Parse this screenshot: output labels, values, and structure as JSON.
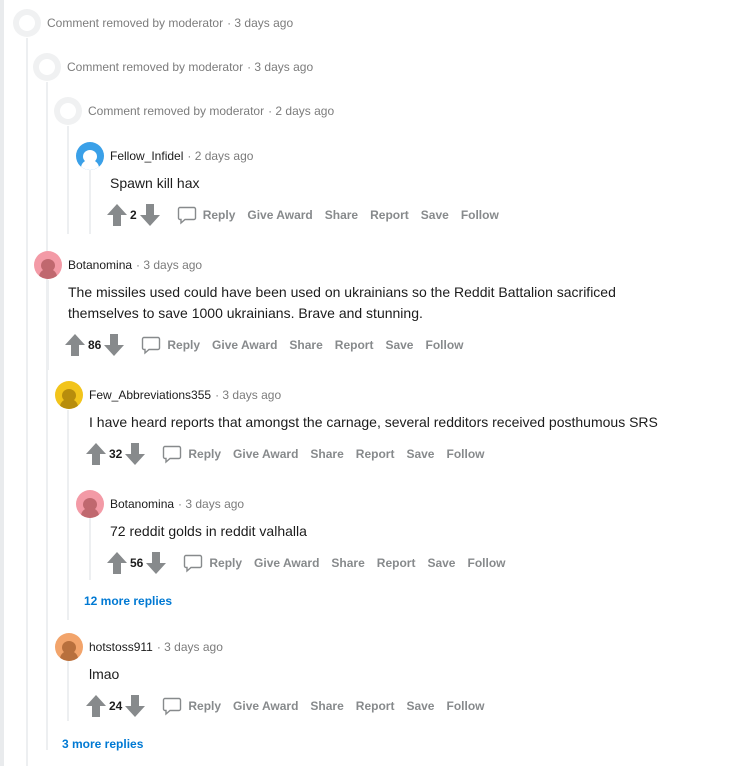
{
  "comments": {
    "c1": {
      "text": "Comment removed by moderator",
      "time": "· 3 days ago"
    },
    "c2": {
      "text": "Comment removed by moderator",
      "time": "· 3 days ago"
    },
    "c3": {
      "text": "Comment removed by moderator",
      "time": "· 2 days ago"
    },
    "c4": {
      "author": "Fellow_Infidel",
      "time": "· 2 days ago",
      "body": "Spawn kill hax",
      "score": "2"
    },
    "c5": {
      "author": "Botanomina",
      "time": "· 3 days ago",
      "body": "The missiles used could have been used on ukrainians so the Reddit Battalion sacrificed themselves to save 1000 ukrainians. Brave and stunning.",
      "score": "86"
    },
    "c6": {
      "author": "Few_Abbreviations355",
      "time": "· 3 days ago",
      "body": "I have heard reports that amongst the carnage, several redditors received posthumous SRS",
      "score": "32"
    },
    "c7": {
      "author": "Botanomina",
      "time": "· 3 days ago",
      "body": "72 reddit golds in reddit valhalla",
      "score": "56"
    },
    "c8": {
      "author": "hotstoss911",
      "time": "· 3 days ago",
      "body": "lmao",
      "score": "24"
    }
  },
  "actions": {
    "reply": "Reply",
    "give_award": "Give Award",
    "share": "Share",
    "report": "Report",
    "save": "Save",
    "follow": "Follow"
  },
  "more_replies": {
    "m1": "12 more replies",
    "m2": "3 more replies"
  },
  "colors": {
    "link": "#0079d3",
    "muted": "#7c7c7c",
    "action": "#878a8c"
  }
}
